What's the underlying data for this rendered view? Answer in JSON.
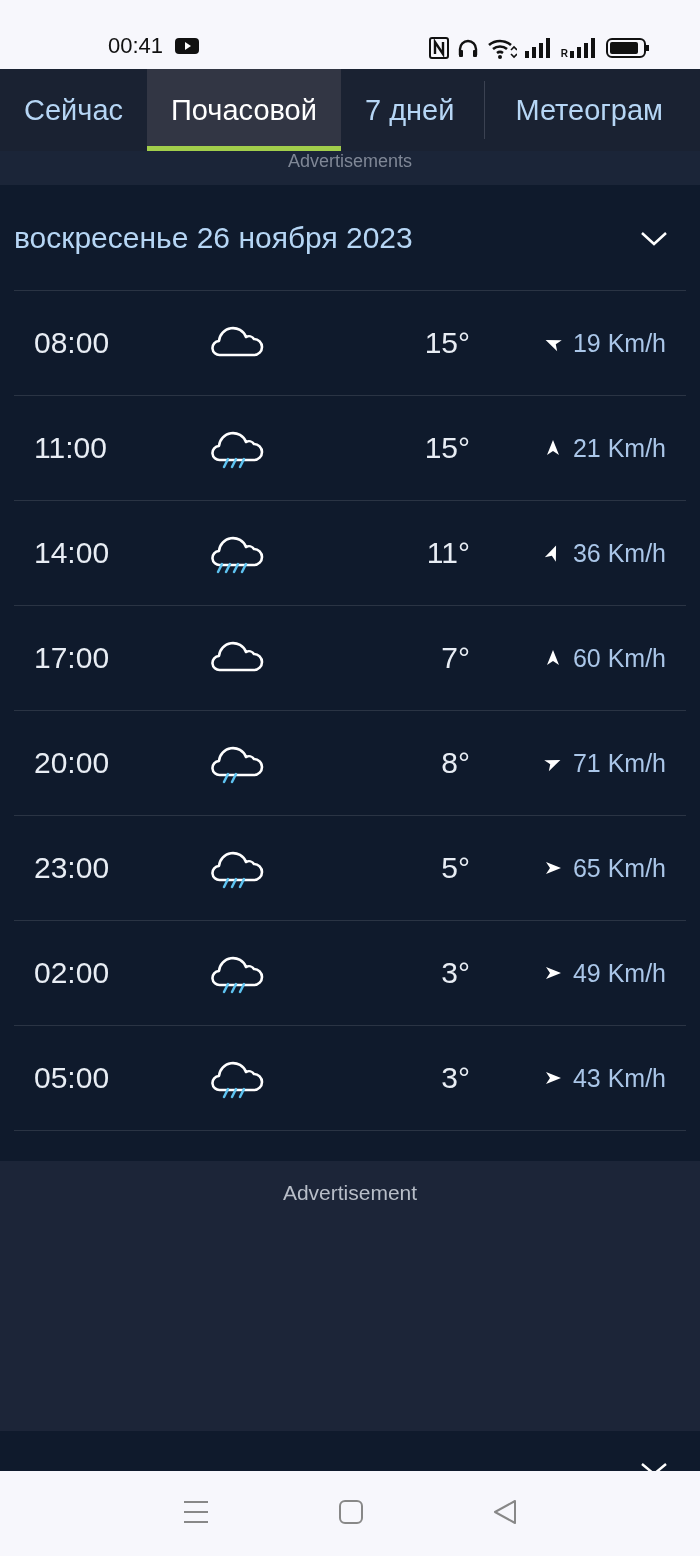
{
  "status_bar": {
    "time": "00:41",
    "roaming_label": "R"
  },
  "tabs": [
    {
      "label": "Сейчас",
      "selected": false
    },
    {
      "label": "Почасовой",
      "selected": true
    },
    {
      "label": "7 дней",
      "selected": false
    },
    {
      "label": "Метеограм",
      "selected": false
    }
  ],
  "top_ad": {
    "label": "Advertisements"
  },
  "day": {
    "title": "воскресенье 26 ноября 2023",
    "expanded": true,
    "rows": [
      {
        "time": "08:00",
        "kind": "cloudy",
        "temperature": "15°",
        "wind": {
          "kind": "wnw",
          "speed": "19 Km/h"
        }
      },
      {
        "time": "11:00",
        "kind": "rain",
        "temperature": "15°",
        "wind": {
          "kind": "n",
          "speed": "21 Km/h"
        }
      },
      {
        "time": "14:00",
        "kind": "heavy_rain",
        "temperature": "11°",
        "wind": {
          "kind": "nne",
          "speed": "36 Km/h"
        }
      },
      {
        "time": "17:00",
        "kind": "cloudy",
        "temperature": "7°",
        "wind": {
          "kind": "n",
          "speed": "60 Km/h"
        }
      },
      {
        "time": "20:00",
        "kind": "light_rain",
        "temperature": "8°",
        "wind": {
          "kind": "ene",
          "speed": "71 Km/h"
        }
      },
      {
        "time": "23:00",
        "kind": "rain",
        "temperature": "5°",
        "wind": {
          "kind": "e",
          "speed": "65 Km/h"
        }
      },
      {
        "time": "02:00",
        "kind": "rain",
        "temperature": "3°",
        "wind": {
          "kind": "e",
          "speed": "49 Km/h"
        }
      },
      {
        "time": "05:00",
        "kind": "rain",
        "temperature": "3°",
        "wind": {
          "kind": "e",
          "speed": "43 Km/h"
        }
      }
    ]
  },
  "ad": {
    "label": "Advertisement"
  }
}
